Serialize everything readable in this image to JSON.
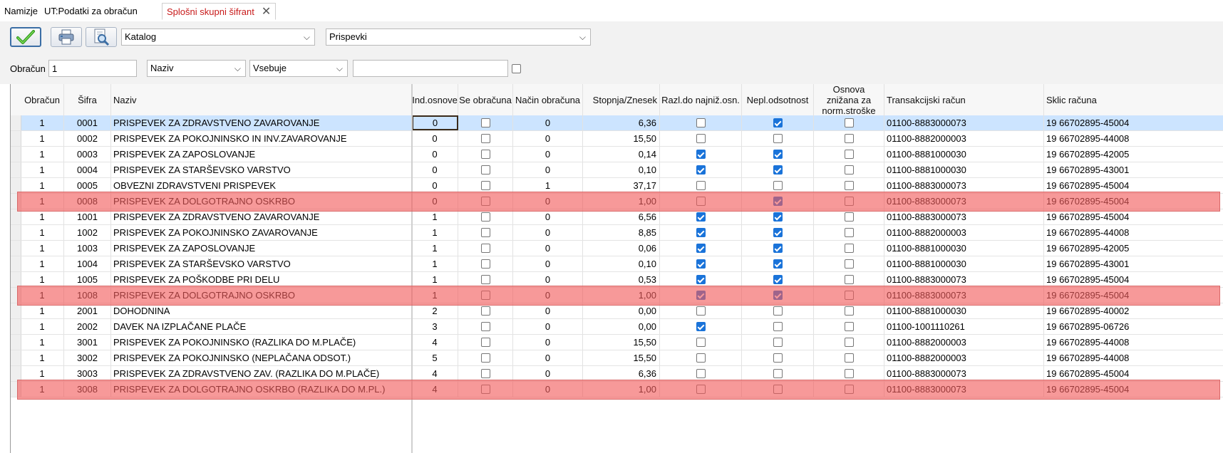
{
  "tabs": [
    {
      "label": "Namizje",
      "active": false
    },
    {
      "label": "UT:Podatki za obračun",
      "active": false
    },
    {
      "label": "Splošni skupni šifrant",
      "active": true
    }
  ],
  "toolbar": {
    "ok_icon": "check-icon",
    "print_icon": "printer-icon",
    "preview_icon": "print-preview-icon",
    "catalog_select": "Katalog",
    "type_select": "Prispevki"
  },
  "filter": {
    "label": "Obračun",
    "value": "1",
    "field_select": "Naziv",
    "operator_select": "Vsebuje",
    "search_value": "",
    "checkbox": false
  },
  "columns": [
    "Obračun",
    "Šifra",
    "Naziv",
    "Ind.osnove",
    "Se obračuna",
    "Način obračuna",
    "Stopnja/Znesek",
    "Razl.do najniž.osn.",
    "Nepl.odsotnost",
    "Osnova znižana za norm.stroške",
    "Transakcijski račun",
    "Sklic računa"
  ],
  "rows": [
    {
      "obracun": "1",
      "sifra": "0001",
      "naziv": "PRISPEVEK ZA ZDRAVSTVENO ZAVAROVANJE",
      "ind": "0",
      "se": false,
      "nacin": "0",
      "stopnja": "6,36",
      "razl": false,
      "nepl": true,
      "osn": false,
      "trr": "01100-8883000073",
      "sklic": "19 66702895-45004"
    },
    {
      "obracun": "1",
      "sifra": "0002",
      "naziv": "PRISPEVEK ZA POKOJNINSKO IN INV.ZAVAROVANJE",
      "ind": "0",
      "se": false,
      "nacin": "0",
      "stopnja": "15,50",
      "razl": false,
      "nepl": false,
      "osn": false,
      "trr": "01100-8882000003",
      "sklic": "19 66702895-44008"
    },
    {
      "obracun": "1",
      "sifra": "0003",
      "naziv": "PRISPEVEK ZA ZAPOSLOVANJE",
      "ind": "0",
      "se": false,
      "nacin": "0",
      "stopnja": "0,14",
      "razl": true,
      "nepl": true,
      "osn": false,
      "trr": "01100-8881000030",
      "sklic": "19 66702895-42005"
    },
    {
      "obracun": "1",
      "sifra": "0004",
      "naziv": "PRISPEVEK ZA STARŠEVSKO VARSTVO",
      "ind": "0",
      "se": false,
      "nacin": "0",
      "stopnja": "0,10",
      "razl": true,
      "nepl": true,
      "osn": false,
      "trr": "01100-8881000030",
      "sklic": "19 66702895-43001"
    },
    {
      "obracun": "1",
      "sifra": "0005",
      "naziv": "OBVEZNI ZDRAVSTVENI PRISPEVEK",
      "ind": "0",
      "se": false,
      "nacin": "1",
      "stopnja": "37,17",
      "razl": false,
      "nepl": false,
      "osn": false,
      "trr": "01100-8883000073",
      "sklic": "19 66702895-45004"
    },
    {
      "obracun": "1",
      "sifra": "0008",
      "naziv": "PRISPEVEK ZA DOLGOTRAJNO OSKRBO",
      "ind": "0",
      "se": false,
      "nacin": "0",
      "stopnja": "1,00",
      "razl": false,
      "nepl": true,
      "osn": false,
      "trr": "01100-8883000073",
      "sklic": "19 66702895-45004"
    },
    {
      "obracun": "1",
      "sifra": "1001",
      "naziv": "PRISPEVEK ZA ZDRAVSTVENO ZAVAROVANJE",
      "ind": "1",
      "se": false,
      "nacin": "0",
      "stopnja": "6,56",
      "razl": true,
      "nepl": true,
      "osn": false,
      "trr": "01100-8883000073",
      "sklic": "19 66702895-45004"
    },
    {
      "obracun": "1",
      "sifra": "1002",
      "naziv": "PRISPEVEK ZA POKOJNINSKO ZAVAROVANJE",
      "ind": "1",
      "se": false,
      "nacin": "0",
      "stopnja": "8,85",
      "razl": true,
      "nepl": true,
      "osn": false,
      "trr": "01100-8882000003",
      "sklic": "19 66702895-44008"
    },
    {
      "obracun": "1",
      "sifra": "1003",
      "naziv": "PRISPEVEK ZA ZAPOSLOVANJE",
      "ind": "1",
      "se": false,
      "nacin": "0",
      "stopnja": "0,06",
      "razl": true,
      "nepl": true,
      "osn": false,
      "trr": "01100-8881000030",
      "sklic": "19 66702895-42005"
    },
    {
      "obracun": "1",
      "sifra": "1004",
      "naziv": "PRISPEVEK ZA STARŠEVSKO VARSTVO",
      "ind": "1",
      "se": false,
      "nacin": "0",
      "stopnja": "0,10",
      "razl": true,
      "nepl": true,
      "osn": false,
      "trr": "01100-8881000030",
      "sklic": "19 66702895-43001"
    },
    {
      "obracun": "1",
      "sifra": "1005",
      "naziv": "PRISPEVEK ZA POŠKODBE PRI DELU",
      "ind": "1",
      "se": false,
      "nacin": "0",
      "stopnja": "0,53",
      "razl": true,
      "nepl": true,
      "osn": false,
      "trr": "01100-8883000073",
      "sklic": "19 66702895-45004"
    },
    {
      "obracun": "1",
      "sifra": "1008",
      "naziv": "PRISPEVEK ZA DOLGOTRAJNO OSKRBO",
      "ind": "1",
      "se": false,
      "nacin": "0",
      "stopnja": "1,00",
      "razl": true,
      "nepl": true,
      "osn": false,
      "trr": "01100-8883000073",
      "sklic": "19 66702895-45004"
    },
    {
      "obracun": "1",
      "sifra": "2001",
      "naziv": "DOHODNINA",
      "ind": "2",
      "se": false,
      "nacin": "0",
      "stopnja": "0,00",
      "razl": false,
      "nepl": false,
      "osn": false,
      "trr": "01100-8881000030",
      "sklic": "19 66702895-40002"
    },
    {
      "obracun": "1",
      "sifra": "2002",
      "naziv": "DAVEK NA IZPLAČANE PLAČE",
      "ind": "3",
      "se": false,
      "nacin": "0",
      "stopnja": "0,00",
      "razl": true,
      "nepl": false,
      "osn": false,
      "trr": "01100-1001110261",
      "sklic": "19 66702895-06726"
    },
    {
      "obracun": "1",
      "sifra": "3001",
      "naziv": "PRISPEVEK ZA POKOJNINSKO (RAZLIKA DO M.PLAČE)",
      "ind": "4",
      "se": false,
      "nacin": "0",
      "stopnja": "15,50",
      "razl": false,
      "nepl": false,
      "osn": false,
      "trr": "01100-8882000003",
      "sklic": "19 66702895-44008"
    },
    {
      "obracun": "1",
      "sifra": "3002",
      "naziv": "PRISPEVEK ZA POKOJNINSKO (NEPLAČANA ODSOT.)",
      "ind": "5",
      "se": false,
      "nacin": "0",
      "stopnja": "15,50",
      "razl": false,
      "nepl": false,
      "osn": false,
      "trr": "01100-8882000003",
      "sklic": "19 66702895-44008"
    },
    {
      "obracun": "1",
      "sifra": "3003",
      "naziv": "PRISPEVEK ZA ZDRAVSTVENO ZAV. (RAZLIKA DO M.PLAČE)",
      "ind": "4",
      "se": false,
      "nacin": "0",
      "stopnja": "6,36",
      "razl": false,
      "nepl": false,
      "osn": false,
      "trr": "01100-8883000073",
      "sklic": "19 66702895-45004"
    },
    {
      "obracun": "1",
      "sifra": "3008",
      "naziv": "PRISPEVEK ZA DOLGOTRAJNO OSKRBO (RAZLIKA DO M.PL.)",
      "ind": "4",
      "se": false,
      "nacin": "0",
      "stopnja": "1,00",
      "razl": false,
      "nepl": false,
      "osn": false,
      "trr": "01100-8883000073",
      "sklic": "19 66702895-45004"
    }
  ],
  "selected_row": 0,
  "highlighted_rows": [
    5,
    11,
    17
  ],
  "colors": {
    "selected_row": "#cce4ff",
    "highlight": "#f25a5a",
    "active_tab": "#c81a1a",
    "checkbox_on": "#1a73d9"
  }
}
